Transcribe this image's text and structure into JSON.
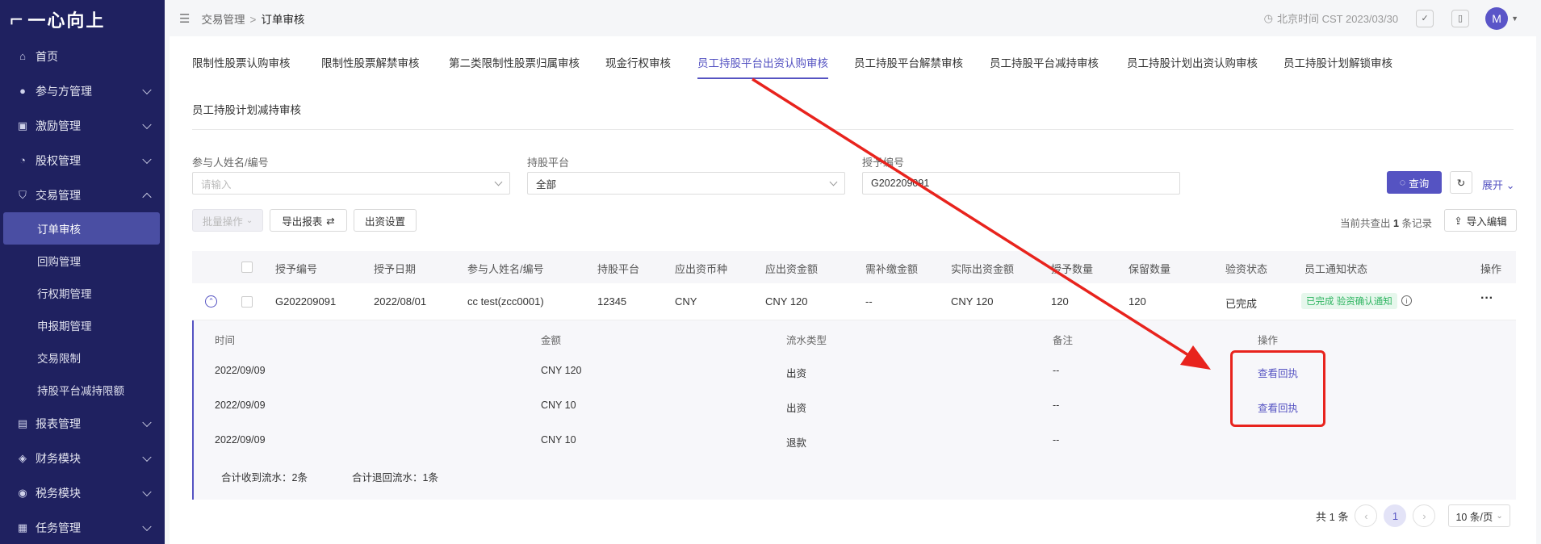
{
  "sidebar": {
    "logo": "一心向上",
    "items": [
      {
        "label": "首页",
        "icon": "home-icon"
      },
      {
        "label": "参与方管理",
        "icon": "user-icon"
      },
      {
        "label": "激励管理",
        "icon": "gift-icon"
      },
      {
        "label": "股权管理",
        "icon": "pie-icon"
      },
      {
        "label": "交易管理",
        "icon": "shield-icon"
      },
      {
        "label": "报表管理",
        "icon": "report-icon"
      },
      {
        "label": "财务模块",
        "icon": "wallet-icon"
      },
      {
        "label": "税务模块",
        "icon": "tax-icon"
      },
      {
        "label": "任务管理",
        "icon": "task-icon"
      }
    ],
    "sub_items": [
      "订单审核",
      "回购管理",
      "行权期管理",
      "申报期管理",
      "交易限制",
      "持股平台减持限额"
    ]
  },
  "header": {
    "breadcrumb": [
      "交易管理",
      "订单审核"
    ],
    "time": "北京时间 CST 2023/03/30",
    "avatar": "M"
  },
  "tabs": [
    "限制性股票认购审核",
    "限制性股票解禁审核",
    "第二类限制性股票归属审核",
    "现金行权审核",
    "员工持股平台出资认购审核",
    "员工持股平台解禁审核",
    "员工持股平台减持审核",
    "员工持股计划出资认购审核",
    "员工持股计划解锁审核",
    "员工持股计划减持审核"
  ],
  "filters": {
    "participant": {
      "label": "参与人姓名/编号",
      "placeholder": "请输入"
    },
    "platform": {
      "label": "持股平台",
      "value": "全部"
    },
    "grant": {
      "label": "授予编号",
      "value": "G202209091"
    },
    "query_label": "查询",
    "expand_label": "展开"
  },
  "toolbar": {
    "batch": "批量操作",
    "export": "导出报表",
    "settings": "出资设置",
    "summary_prefix": "当前共查出",
    "summary_count": "1",
    "summary_suffix": "条记录",
    "import": "导入编辑"
  },
  "table": {
    "columns": [
      "授予编号",
      "授予日期",
      "参与人姓名/编号",
      "持股平台",
      "应出资币种",
      "应出资金额",
      "需补缴金额",
      "实际出资金额",
      "授予数量",
      "保留数量",
      "验资状态",
      "员工通知状态",
      "操作"
    ],
    "row": {
      "grant_no": "G202209091",
      "date": "2022/08/01",
      "participant": "cc test(zcc0001)",
      "platform": "12345",
      "currency": "CNY",
      "amount": "CNY 120",
      "supplement": "--",
      "actual": "CNY 120",
      "qty": "120",
      "reserved": "120",
      "verify": "已完成",
      "notify": "已完成 验资确认通知",
      "more": "···"
    }
  },
  "sub_table": {
    "columns": [
      "时间",
      "金额",
      "流水类型",
      "备注",
      "操作"
    ],
    "rows": [
      {
        "time": "2022/09/09",
        "amount": "CNY 120",
        "type": "出资",
        "note": "--",
        "action": "查看回执"
      },
      {
        "time": "2022/09/09",
        "amount": "CNY 10",
        "type": "出资",
        "note": "--",
        "action": "查看回执"
      },
      {
        "time": "2022/09/09",
        "amount": "CNY 10",
        "type": "退款",
        "note": "--",
        "action": ""
      }
    ],
    "total_in": "合计收到流水：2条",
    "total_out": "合计退回流水：1条"
  },
  "pagination": {
    "total": "共 1 条",
    "current": "1",
    "size": "10 条/页"
  },
  "colors": {
    "sidebar": "#1f2160",
    "accent": "#5553c2",
    "annotation": "#e8231d",
    "success": "#2fb561"
  }
}
